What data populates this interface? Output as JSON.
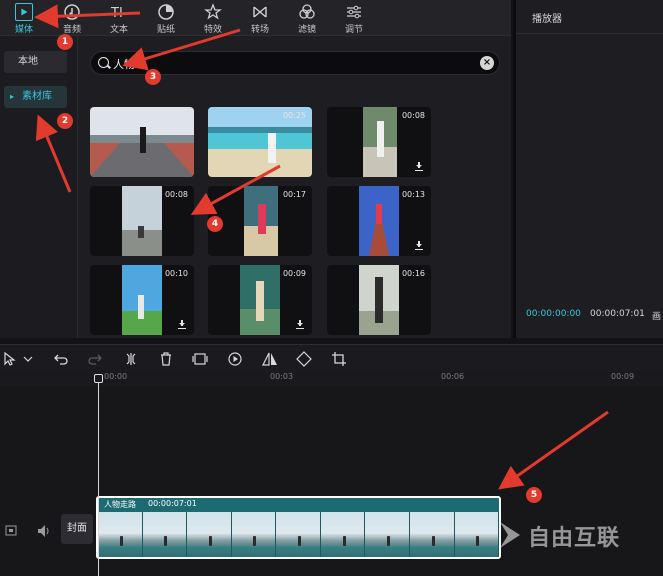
{
  "toolbar": {
    "tabs": [
      {
        "label": "媒体",
        "icon": "media-icon",
        "active": true
      },
      {
        "label": "音频",
        "icon": "audio-icon"
      },
      {
        "label": "文本",
        "icon": "text-icon"
      },
      {
        "label": "贴纸",
        "icon": "sticker-icon"
      },
      {
        "label": "特效",
        "icon": "effects-icon"
      },
      {
        "label": "转场",
        "icon": "transition-icon"
      },
      {
        "label": "滤镜",
        "icon": "filter-icon"
      },
      {
        "label": "调节",
        "icon": "adjust-icon"
      }
    ]
  },
  "sidebar": {
    "items": [
      {
        "label": "本地"
      },
      {
        "label": "素材库",
        "active": true
      }
    ]
  },
  "search": {
    "value": "人物"
  },
  "media_grid": [
    {
      "duration": "",
      "download": false
    },
    {
      "duration": "00:25",
      "download": false
    },
    {
      "duration": "00:08",
      "download": true
    },
    {
      "duration": "00:08",
      "download": false
    },
    {
      "duration": "00:17",
      "download": false
    },
    {
      "duration": "00:13",
      "download": true
    },
    {
      "duration": "00:10",
      "download": true
    },
    {
      "duration": "00:09",
      "download": true
    },
    {
      "duration": "00:16",
      "download": false
    }
  ],
  "player": {
    "title": "播放器",
    "current_time": "00:00:00:00",
    "total_time": "00:00:07:01",
    "extra_label": "画"
  },
  "timeline": {
    "ruler_ticks": [
      "00:00",
      "00:03",
      "00:06",
      "00:09"
    ],
    "cover_label": "封面",
    "clip": {
      "title": "人物走路",
      "duration": "00:00:07:01"
    }
  },
  "annotations": [
    "1",
    "2",
    "3",
    "4",
    "5"
  ],
  "watermark": {
    "text": "自由互联"
  },
  "colors": {
    "accent": "#38c6d9",
    "annotation": "#e23a2d"
  }
}
